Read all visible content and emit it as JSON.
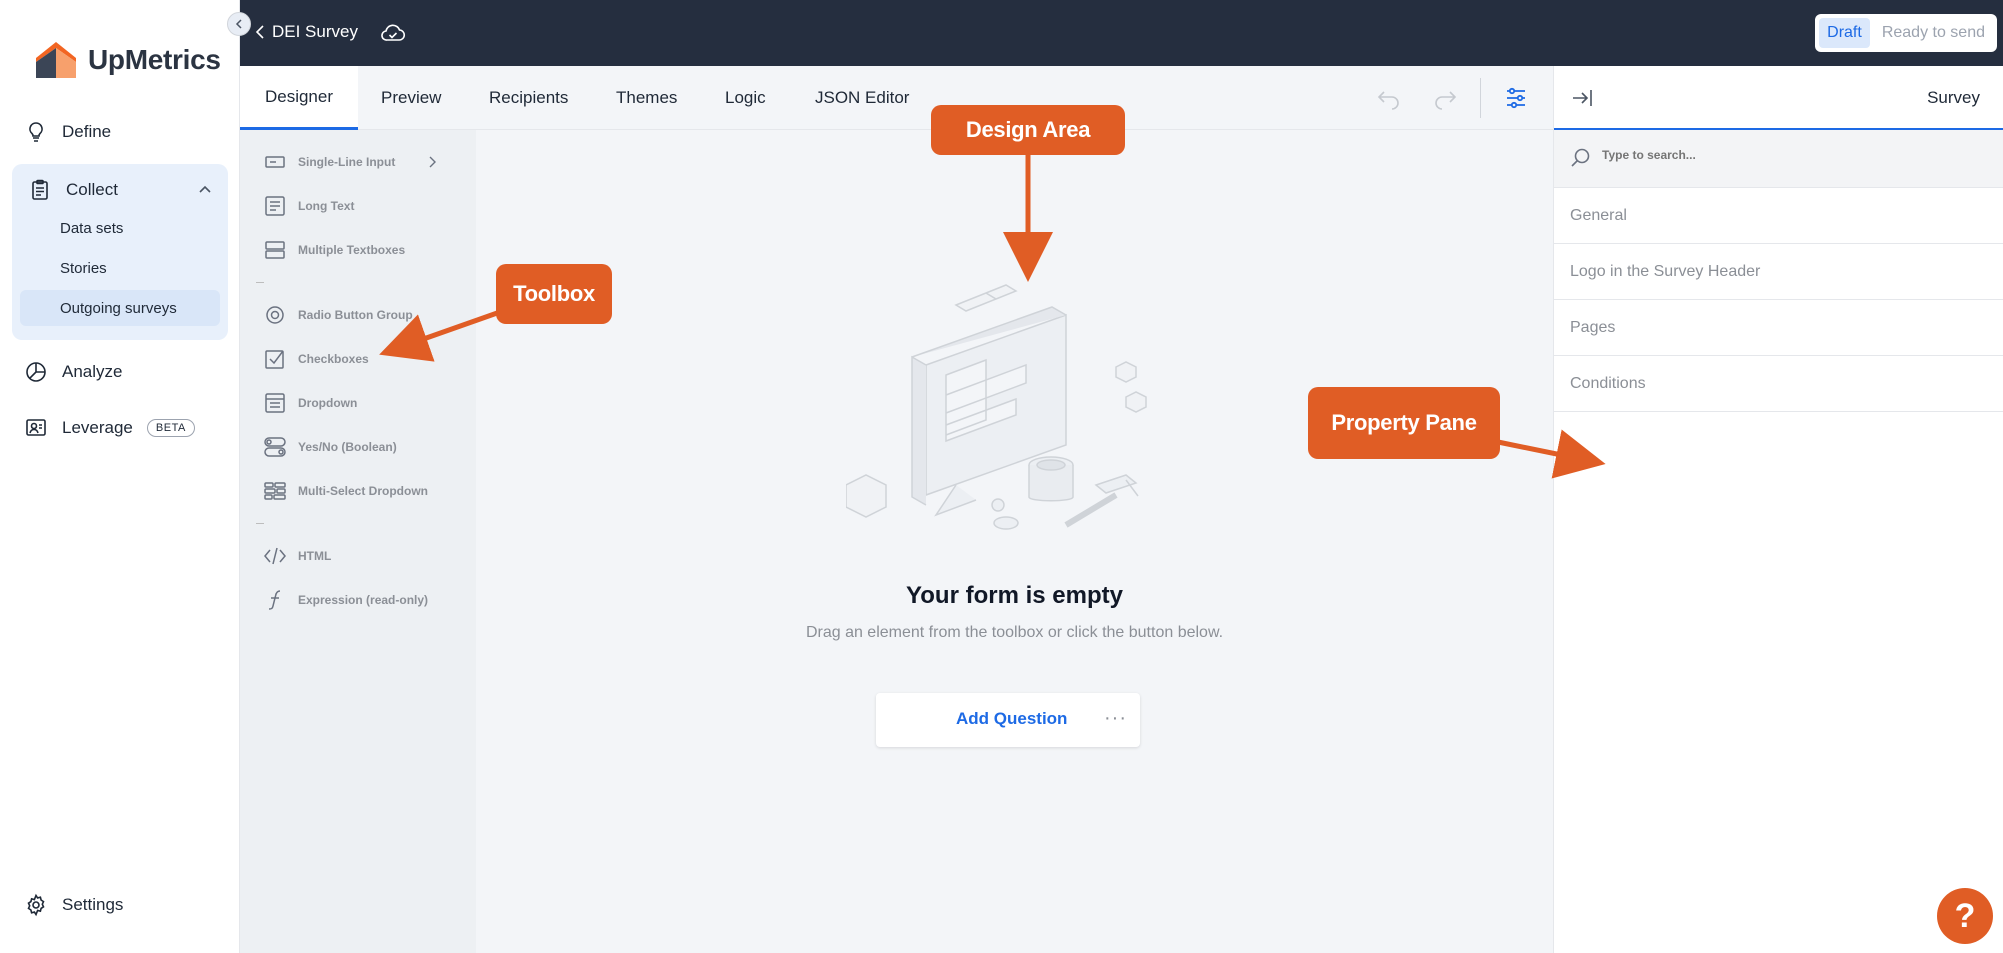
{
  "app": {
    "logo_text": "UpMetrics"
  },
  "sidebar": {
    "define": "Define",
    "collect": {
      "label": "Collect",
      "items": [
        "Data sets",
        "Stories",
        "Outgoing surveys"
      ]
    },
    "analyze": "Analyze",
    "leverage": "Leverage",
    "leverage_badge": "BETA",
    "settings": "Settings"
  },
  "topbar": {
    "back_label": "DEI Survey",
    "status_options": [
      "Draft",
      "Ready to send"
    ],
    "status_selected": "Draft"
  },
  "tabs": [
    "Designer",
    "Preview",
    "Recipients",
    "Themes",
    "Logic",
    "JSON Editor"
  ],
  "active_tab": "Designer",
  "toolbox": {
    "items": [
      {
        "label": "Single-Line Input",
        "icon": "single-line-input-icon"
      },
      {
        "label": "Long Text",
        "icon": "long-text-icon"
      },
      {
        "label": "Multiple Textboxes",
        "icon": "multiple-textboxes-icon"
      },
      {
        "label": "Radio Button Group",
        "icon": "radio-button-icon"
      },
      {
        "label": "Checkboxes",
        "icon": "checkbox-icon"
      },
      {
        "label": "Dropdown",
        "icon": "dropdown-icon"
      },
      {
        "label": "Yes/No (Boolean)",
        "icon": "boolean-toggle-icon"
      },
      {
        "label": "Multi-Select Dropdown",
        "icon": "multi-select-icon"
      },
      {
        "label": "HTML",
        "icon": "html-code-icon"
      },
      {
        "label": "Expression (read-only)",
        "icon": "expression-icon"
      }
    ]
  },
  "design": {
    "empty_title": "Your form is empty",
    "empty_subtitle": "Drag an element from the toolbox or click the button below.",
    "add_question": "Add Question"
  },
  "property_pane": {
    "title": "Survey",
    "search_placeholder": "Type to search...",
    "sections": [
      "General",
      "Logo in the Survey Header",
      "Pages",
      "Conditions"
    ]
  },
  "callouts": {
    "toolbox": "Toolbox",
    "design_area": "Design Area",
    "property_pane": "Property Pane"
  },
  "help_label": "?",
  "colors": {
    "accent": "#1d6ae5",
    "callout": "#e05d25",
    "topbar": "#252e3f",
    "logo_orange": "#f26522"
  }
}
